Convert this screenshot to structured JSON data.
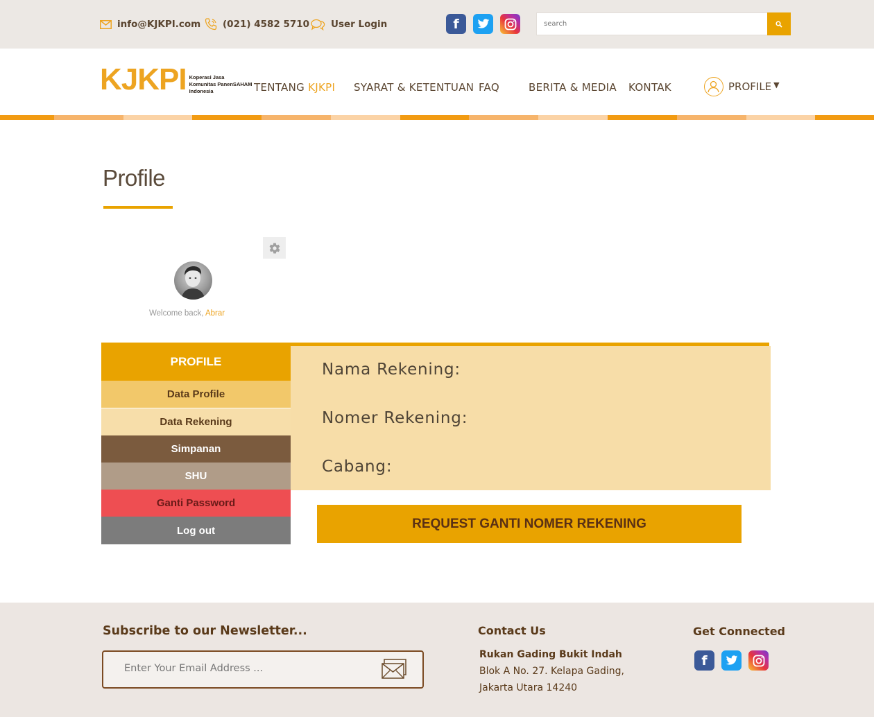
{
  "topbar": {
    "email": "info@KJKPI.com",
    "phone": "(021) 4582 5710",
    "login": "User Login",
    "social_icons": [
      "facebook-icon",
      "twitter-icon",
      "instagram-icon"
    ],
    "search_placeholder": "search"
  },
  "header": {
    "logo_mark": "KJKPI",
    "logo_line1": "Koperasi Jasa",
    "logo_line2": "Komunitas PanenSAHAM",
    "logo_line3": "Indonesia",
    "nav": {
      "tentang_prefix": "TENTANG",
      "tentang_suffix": "KJKPI",
      "syarat": "SYARAT & KETENTUAN",
      "faq": "FAQ",
      "berita": "BERITA & MEDIA",
      "kontak": "KONTAK",
      "profile": "PROFILE",
      "caret": "▼"
    }
  },
  "page": {
    "title": "Profile",
    "welcome_prefix": "Welcome back,",
    "username": "Abrar"
  },
  "sidebar": {
    "heading": "PROFILE",
    "items": [
      {
        "label": "Data Profile"
      },
      {
        "label": "Data Rekening"
      },
      {
        "label": "Simpanan"
      },
      {
        "label": "SHU"
      },
      {
        "label": "Ganti Password"
      },
      {
        "label": "Log out"
      }
    ]
  },
  "details": {
    "nama_rekening": "Nama Rekening:",
    "nomer_rekening": "Nomer Rekening:",
    "cabang": "Cabang:",
    "request_button": "REQUEST GANTI NOMER REKENING"
  },
  "footer": {
    "newsletter_title": "Subscribe to our Newsletter...",
    "newsletter_placeholder": "Enter Your Email Address ...",
    "contact_title": "Contact Us",
    "address_name": "Rukan Gading Bukit Indah",
    "address_line1": "Blok A No. 27. Kelapa Gading,",
    "address_line2": "Jakarta Utara 14240",
    "connected_title": "Get Connected"
  },
  "colors": {
    "accent": "#e9a300",
    "brand_orange": "#eda421",
    "topbar_bg": "#ece8e4",
    "brown_text": "#5a3a1a",
    "menu_simpanan": "#7b5b3e",
    "menu_shu": "#b09c88",
    "menu_password": "#ee4e52",
    "menu_logout": "#7c7c7c",
    "panel_bg": "#f7dda8"
  }
}
